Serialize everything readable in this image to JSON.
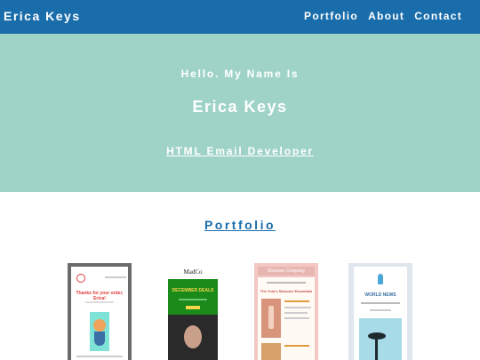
{
  "nav": {
    "brand": "Erica Keys",
    "links": [
      "Portfolio",
      "About",
      "Contact"
    ]
  },
  "hero": {
    "greeting": "Hello. My Name Is",
    "name": "Erica Keys",
    "role": "HTML Email Developer"
  },
  "portfolio": {
    "title": "Portfolio",
    "items": [
      {
        "headline": "Thanks for your order, Erica!"
      },
      {
        "brand": "MadCo",
        "headline": "DECEMBER DEALS"
      },
      {
        "brand": "Skincare Company",
        "headline": "The Year's Skincare Essentials"
      },
      {
        "headline": "WORLD NEWS"
      }
    ]
  },
  "colors": {
    "nav": "#1a6dab",
    "hero": "#9fd3c7",
    "accent": "#1a6dab"
  }
}
